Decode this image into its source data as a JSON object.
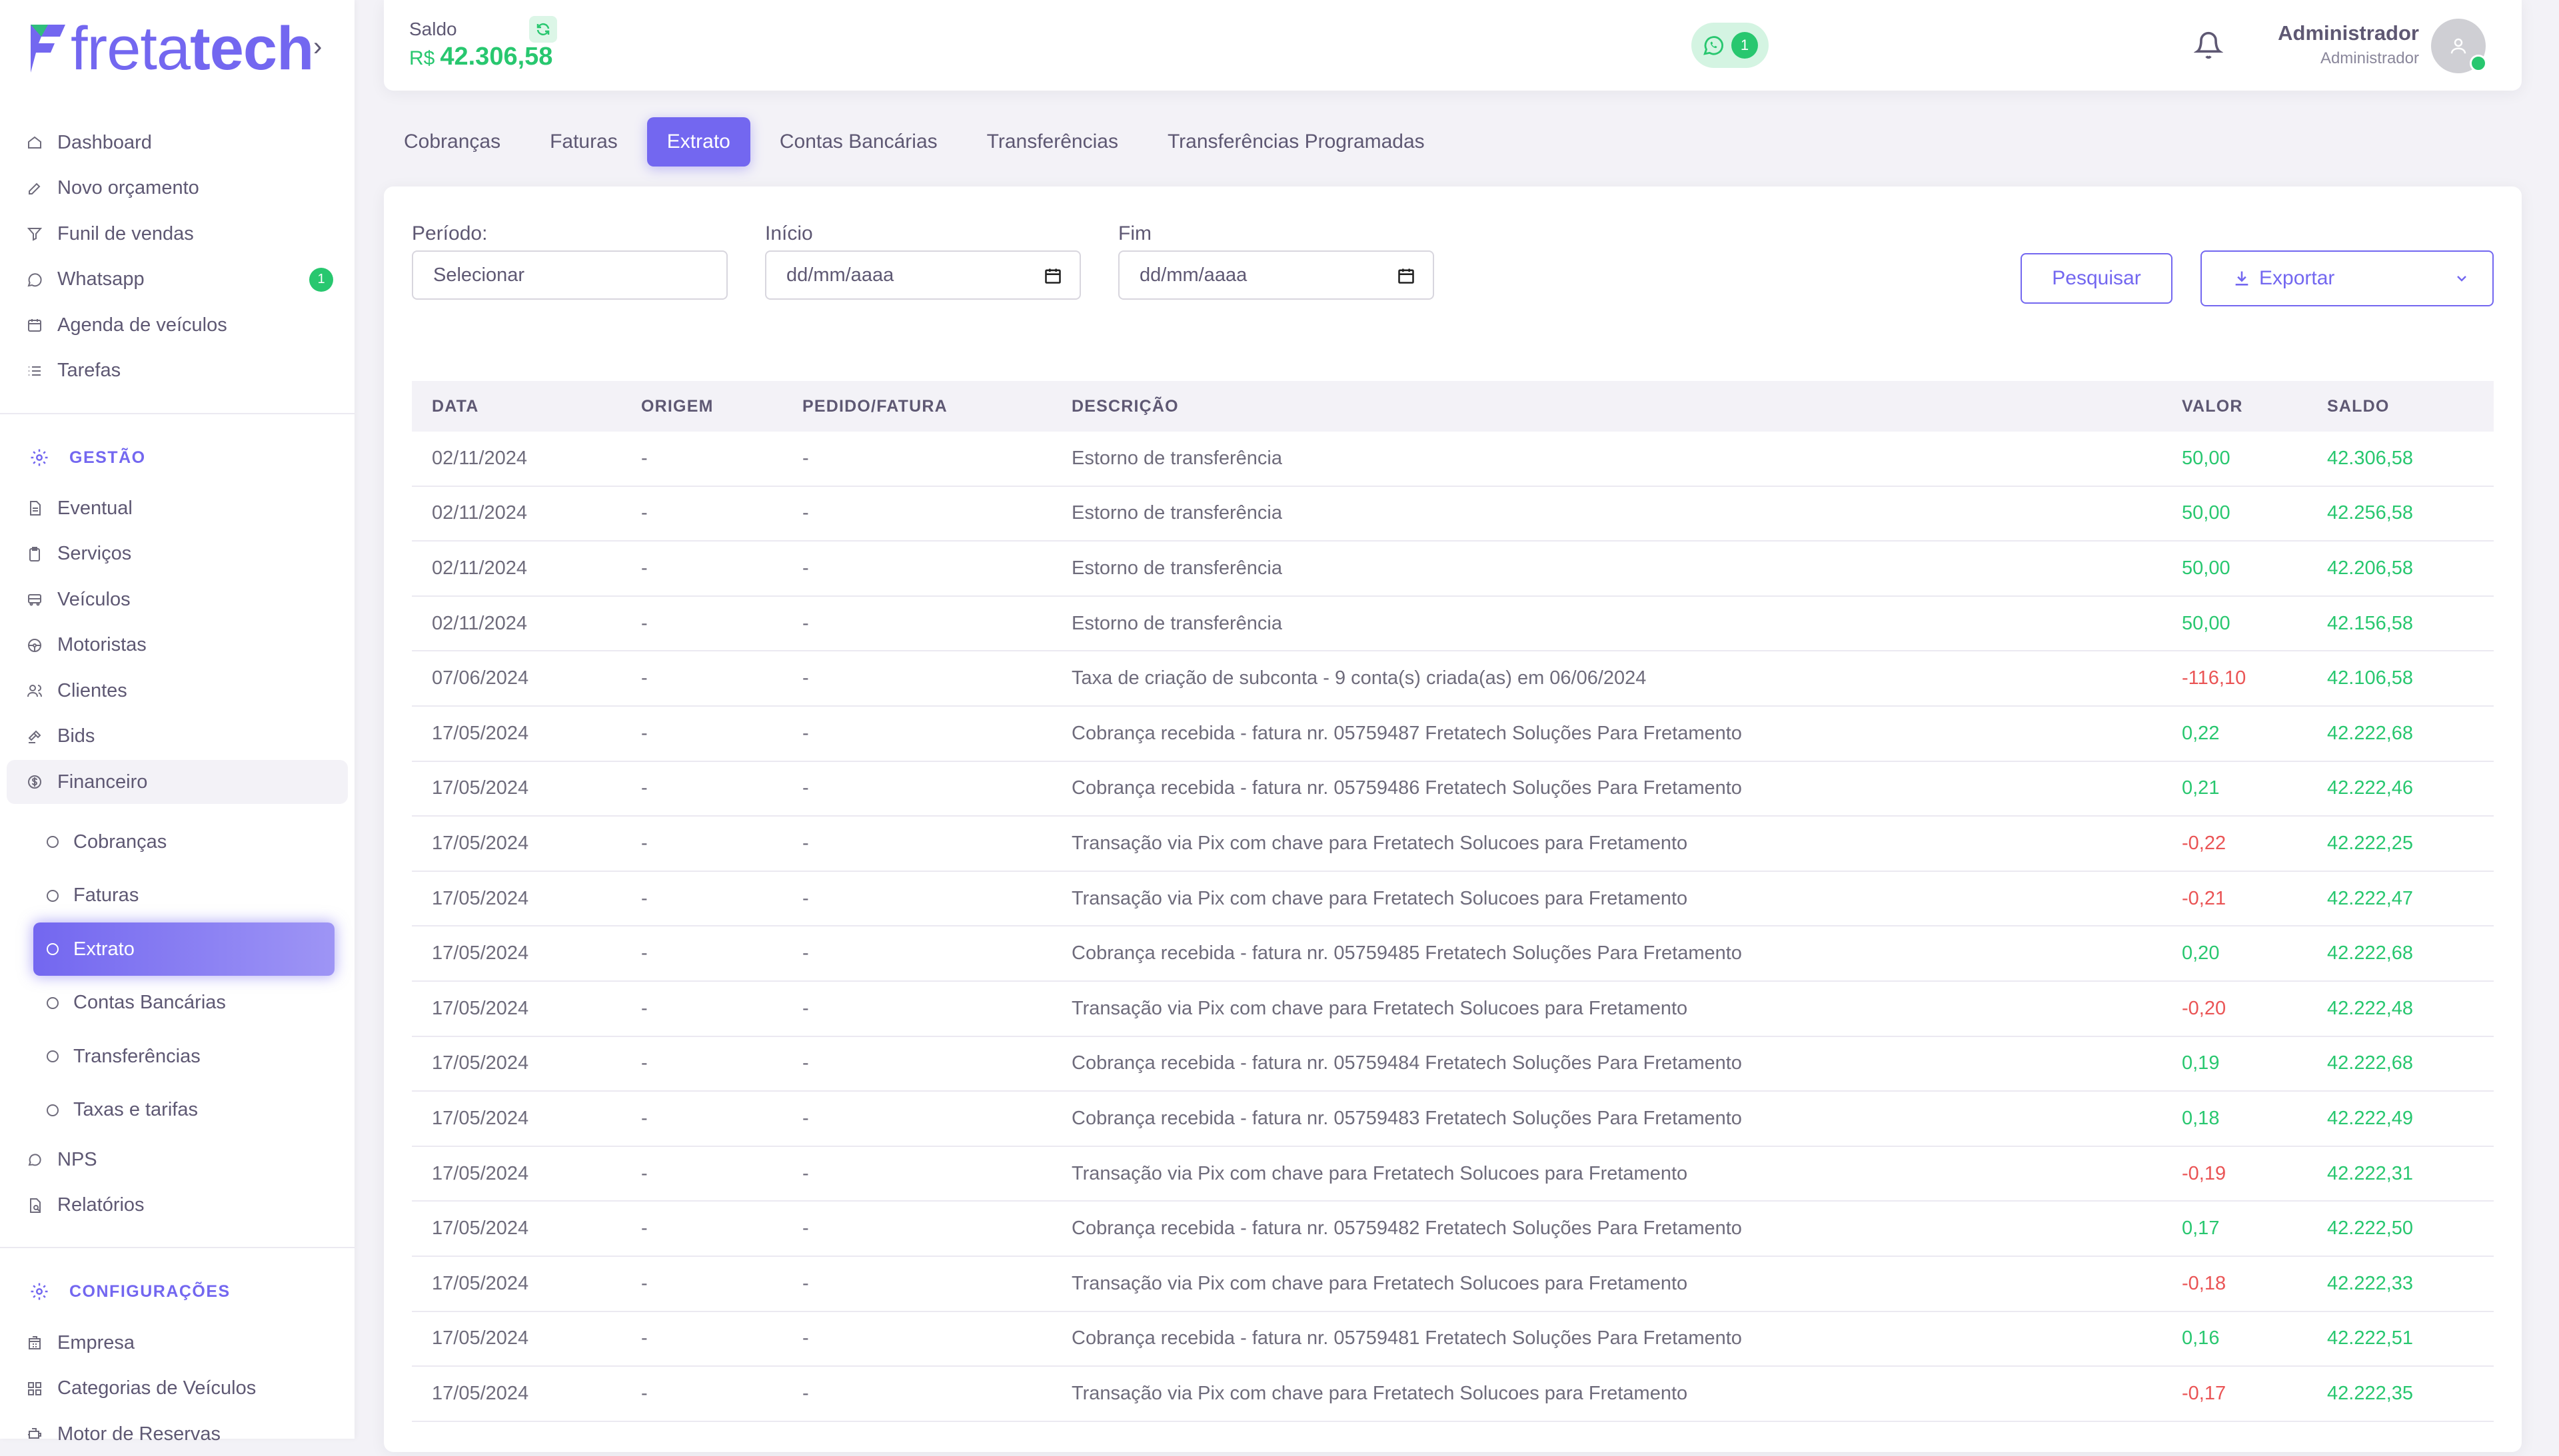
{
  "brand": {
    "name_light": "freta",
    "name_bold": "tech"
  },
  "sidebar": {
    "top_items": [
      {
        "label": "Dashboard",
        "icon": "home-icon"
      },
      {
        "label": "Novo orçamento",
        "icon": "edit-icon"
      },
      {
        "label": "Funil de vendas",
        "icon": "funnel-icon"
      },
      {
        "label": "Whatsapp",
        "icon": "whatsapp-icon",
        "badge": "1"
      },
      {
        "label": "Agenda de veículos",
        "icon": "calendar-icon"
      },
      {
        "label": "Tarefas",
        "icon": "list-icon"
      }
    ],
    "gestao_title": "GESTÃO",
    "gestao_items": [
      {
        "label": "Eventual",
        "icon": "file-icon"
      },
      {
        "label": "Serviços",
        "icon": "clipboard-icon"
      },
      {
        "label": "Veículos",
        "icon": "bus-icon"
      },
      {
        "label": "Motoristas",
        "icon": "steering-wheel-icon"
      },
      {
        "label": "Clientes",
        "icon": "users-icon"
      },
      {
        "label": "Bids",
        "icon": "gavel-icon"
      },
      {
        "label": "Financeiro",
        "icon": "dollar-icon"
      }
    ],
    "financeiro_sub": [
      {
        "label": "Cobranças"
      },
      {
        "label": "Faturas"
      },
      {
        "label": "Extrato",
        "active": true
      },
      {
        "label": "Contas Bancárias"
      },
      {
        "label": "Transferências"
      },
      {
        "label": "Taxas e tarifas"
      }
    ],
    "after_items": [
      {
        "label": "NPS",
        "icon": "message-icon"
      },
      {
        "label": "Relatórios",
        "icon": "report-icon"
      }
    ],
    "config_title": "CONFIGURAÇÕES",
    "config_items": [
      {
        "label": "Empresa",
        "icon": "building-icon"
      },
      {
        "label": "Categorias de Veículos",
        "icon": "grid-icon"
      },
      {
        "label": "Motor de Reservas",
        "icon": "engine-icon"
      }
    ]
  },
  "header": {
    "saldo_label": "Saldo",
    "saldo_currency": "R$",
    "saldo_value": "42.306,58",
    "whatsapp_count": "1",
    "user_name": "Administrador",
    "user_role": "Administrador"
  },
  "tabs": [
    "Cobranças",
    "Faturas",
    "Extrato",
    "Contas Bancárias",
    "Transferências",
    "Transferências Programadas"
  ],
  "active_tab": "Extrato",
  "filters": {
    "periodo_label": "Período:",
    "periodo_value": "Selecionar",
    "inicio_label": "Início",
    "inicio_placeholder": "dd/mm/aaaa",
    "fim_label": "Fim",
    "fim_placeholder": "dd/mm/aaaa",
    "search_button": "Pesquisar",
    "export_button": "Exportar"
  },
  "table": {
    "columns": [
      "DATA",
      "ORIGEM",
      "PEDIDO/FATURA",
      "DESCRIÇÃO",
      "VALOR",
      "SALDO"
    ],
    "rows": [
      {
        "data": "02/11/2024",
        "origem": "-",
        "pedido": "-",
        "descricao": "Estorno de transferência",
        "valor": "50,00",
        "saldo": "42.306,58",
        "neg": false
      },
      {
        "data": "02/11/2024",
        "origem": "-",
        "pedido": "-",
        "descricao": "Estorno de transferência",
        "valor": "50,00",
        "saldo": "42.256,58",
        "neg": false
      },
      {
        "data": "02/11/2024",
        "origem": "-",
        "pedido": "-",
        "descricao": "Estorno de transferência",
        "valor": "50,00",
        "saldo": "42.206,58",
        "neg": false
      },
      {
        "data": "02/11/2024",
        "origem": "-",
        "pedido": "-",
        "descricao": "Estorno de transferência",
        "valor": "50,00",
        "saldo": "42.156,58",
        "neg": false
      },
      {
        "data": "07/06/2024",
        "origem": "-",
        "pedido": "-",
        "descricao": "Taxa de criação de subconta - 9 conta(s) criada(as) em 06/06/2024",
        "valor": "-116,10",
        "saldo": "42.106,58",
        "neg": true
      },
      {
        "data": "17/05/2024",
        "origem": "-",
        "pedido": "-",
        "descricao": "Cobrança recebida - fatura nr. 05759487 Fretatech Soluções Para Fretamento",
        "valor": "0,22",
        "saldo": "42.222,68",
        "neg": false
      },
      {
        "data": "17/05/2024",
        "origem": "-",
        "pedido": "-",
        "descricao": "Cobrança recebida - fatura nr. 05759486 Fretatech Soluções Para Fretamento",
        "valor": "0,21",
        "saldo": "42.222,46",
        "neg": false
      },
      {
        "data": "17/05/2024",
        "origem": "-",
        "pedido": "-",
        "descricao": "Transação via Pix com chave para Fretatech Solucoes para Fretamento",
        "valor": "-0,22",
        "saldo": "42.222,25",
        "neg": true
      },
      {
        "data": "17/05/2024",
        "origem": "-",
        "pedido": "-",
        "descricao": "Transação via Pix com chave para Fretatech Solucoes para Fretamento",
        "valor": "-0,21",
        "saldo": "42.222,47",
        "neg": true
      },
      {
        "data": "17/05/2024",
        "origem": "-",
        "pedido": "-",
        "descricao": "Cobrança recebida - fatura nr. 05759485 Fretatech Soluções Para Fretamento",
        "valor": "0,20",
        "saldo": "42.222,68",
        "neg": false
      },
      {
        "data": "17/05/2024",
        "origem": "-",
        "pedido": "-",
        "descricao": "Transação via Pix com chave para Fretatech Solucoes para Fretamento",
        "valor": "-0,20",
        "saldo": "42.222,48",
        "neg": true
      },
      {
        "data": "17/05/2024",
        "origem": "-",
        "pedido": "-",
        "descricao": "Cobrança recebida - fatura nr. 05759484 Fretatech Soluções Para Fretamento",
        "valor": "0,19",
        "saldo": "42.222,68",
        "neg": false
      },
      {
        "data": "17/05/2024",
        "origem": "-",
        "pedido": "-",
        "descricao": "Cobrança recebida - fatura nr. 05759483 Fretatech Soluções Para Fretamento",
        "valor": "0,18",
        "saldo": "42.222,49",
        "neg": false
      },
      {
        "data": "17/05/2024",
        "origem": "-",
        "pedido": "-",
        "descricao": "Transação via Pix com chave para Fretatech Solucoes para Fretamento",
        "valor": "-0,19",
        "saldo": "42.222,31",
        "neg": true
      },
      {
        "data": "17/05/2024",
        "origem": "-",
        "pedido": "-",
        "descricao": "Cobrança recebida - fatura nr. 05759482 Fretatech Soluções Para Fretamento",
        "valor": "0,17",
        "saldo": "42.222,50",
        "neg": false
      },
      {
        "data": "17/05/2024",
        "origem": "-",
        "pedido": "-",
        "descricao": "Transação via Pix com chave para Fretatech Solucoes para Fretamento",
        "valor": "-0,18",
        "saldo": "42.222,33",
        "neg": true
      },
      {
        "data": "17/05/2024",
        "origem": "-",
        "pedido": "-",
        "descricao": "Cobrança recebida - fatura nr. 05759481 Fretatech Soluções Para Fretamento",
        "valor": "0,16",
        "saldo": "42.222,51",
        "neg": false
      },
      {
        "data": "17/05/2024",
        "origem": "-",
        "pedido": "-",
        "descricao": "Transação via Pix com chave para Fretatech Solucoes para Fretamento",
        "valor": "-0,17",
        "saldo": "42.222,35",
        "neg": true
      }
    ]
  },
  "colors": {
    "accent": "#7367f0",
    "positive": "#28c76f",
    "negative": "#ea5455"
  }
}
